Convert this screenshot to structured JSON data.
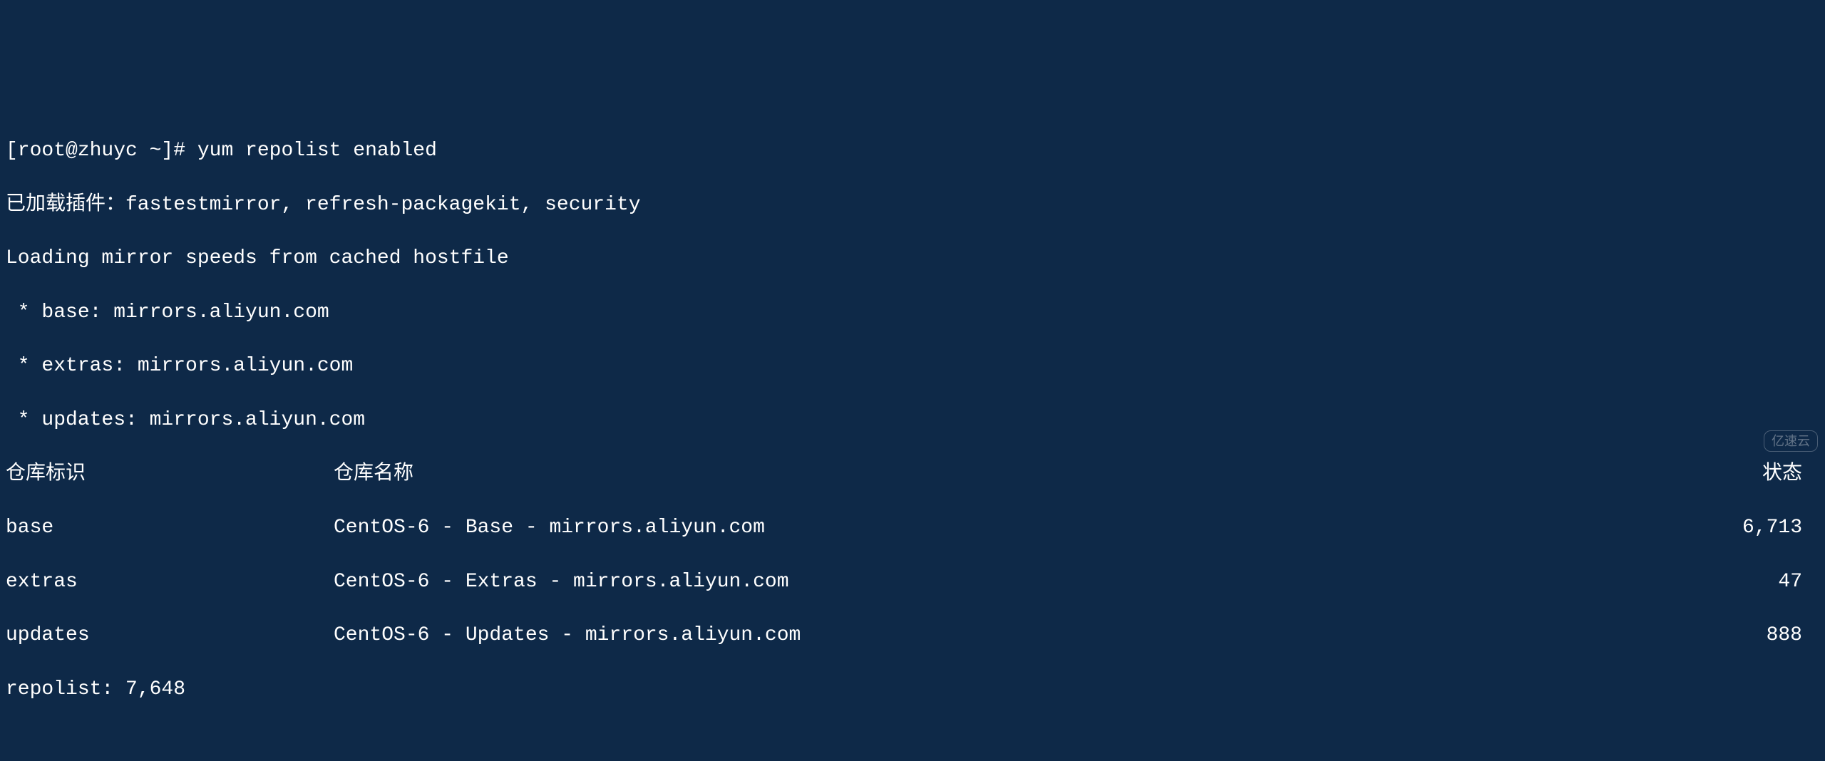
{
  "prompt": {
    "prefix": "[root@zhuyc ~]# ",
    "command": "yum repolist enabled"
  },
  "output": {
    "plugins_line": "已加载插件：fastestmirror, refresh-packagekit, security",
    "loading_line": "Loading mirror speeds from cached hostfile",
    "mirrors": [
      " * base: mirrors.aliyun.com",
      " * extras: mirrors.aliyun.com",
      " * updates: mirrors.aliyun.com"
    ],
    "headers": {
      "id": "仓库标识",
      "name": "仓库名称",
      "status": "状态"
    },
    "rows": [
      {
        "id": "base",
        "name": "CentOS-6 - Base - mirrors.aliyun.com",
        "status": "6,713"
      },
      {
        "id": "extras",
        "name": "CentOS-6 - Extras - mirrors.aliyun.com",
        "status": "47"
      },
      {
        "id": "updates",
        "name": "CentOS-6 - Updates - mirrors.aliyun.com",
        "status": "888"
      }
    ],
    "summary": "repolist: 7,648"
  },
  "watermark": "亿速云"
}
